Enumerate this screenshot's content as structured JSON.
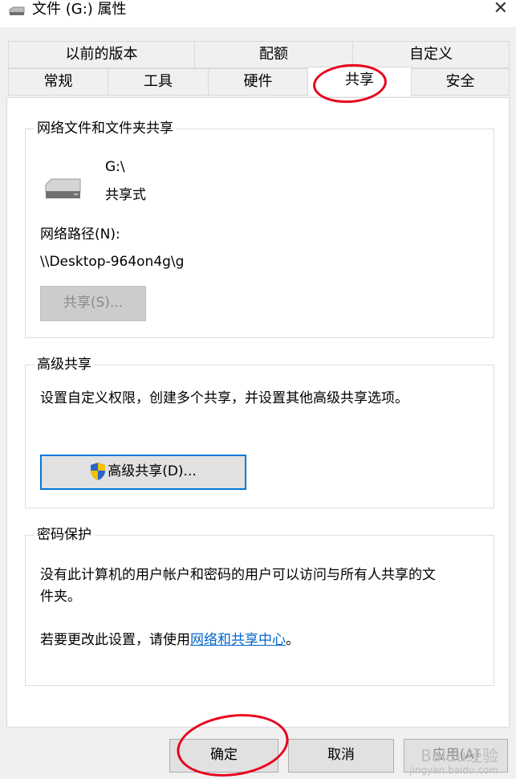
{
  "window": {
    "title": "文件 (G:) 属性",
    "close_glyph": "✕"
  },
  "tabs_row1": [
    "以前的版本",
    "配额",
    "自定义"
  ],
  "tabs_row2": [
    "常规",
    "工具",
    "硬件",
    "共享",
    "安全"
  ],
  "selected_tab": "共享",
  "network_sharing": {
    "group_title": "网络文件和文件夹共享",
    "drive_name": "G:\\",
    "share_state": "共享式",
    "path_label": "网络路径(N):",
    "path_value": "\\\\Desktop-964on4g\\g",
    "share_button": "共享(S)..."
  },
  "advanced_sharing": {
    "group_title": "高级共享",
    "description": "设置自定义权限，创建多个共享，并设置其他高级共享选项。",
    "button_label": "高级共享(D)..."
  },
  "password_protection": {
    "group_title": "密码保护",
    "description_line1": "没有此计算机的用户帐户和密码的用户可以访问与所有人共享的文",
    "description_line2": "件夹。",
    "change_prefix": "若要更改此设置，请使用",
    "link_text": "网络和共享中心",
    "change_suffix": "。"
  },
  "footer": {
    "ok_label": "确定",
    "cancel_label": "取消",
    "apply_label": "应用(A)"
  },
  "watermark": {
    "text": "Baidu经验",
    "subtext": "jingyan.baidu.com"
  },
  "colors": {
    "accent": "#0078d7",
    "annotation": "#e8001c",
    "link": "#0066cc",
    "shield_blue": "#2a64c4",
    "shield_yellow": "#f2c200"
  },
  "icons": [
    "drive-icon",
    "close-icon",
    "shield-icon"
  ]
}
